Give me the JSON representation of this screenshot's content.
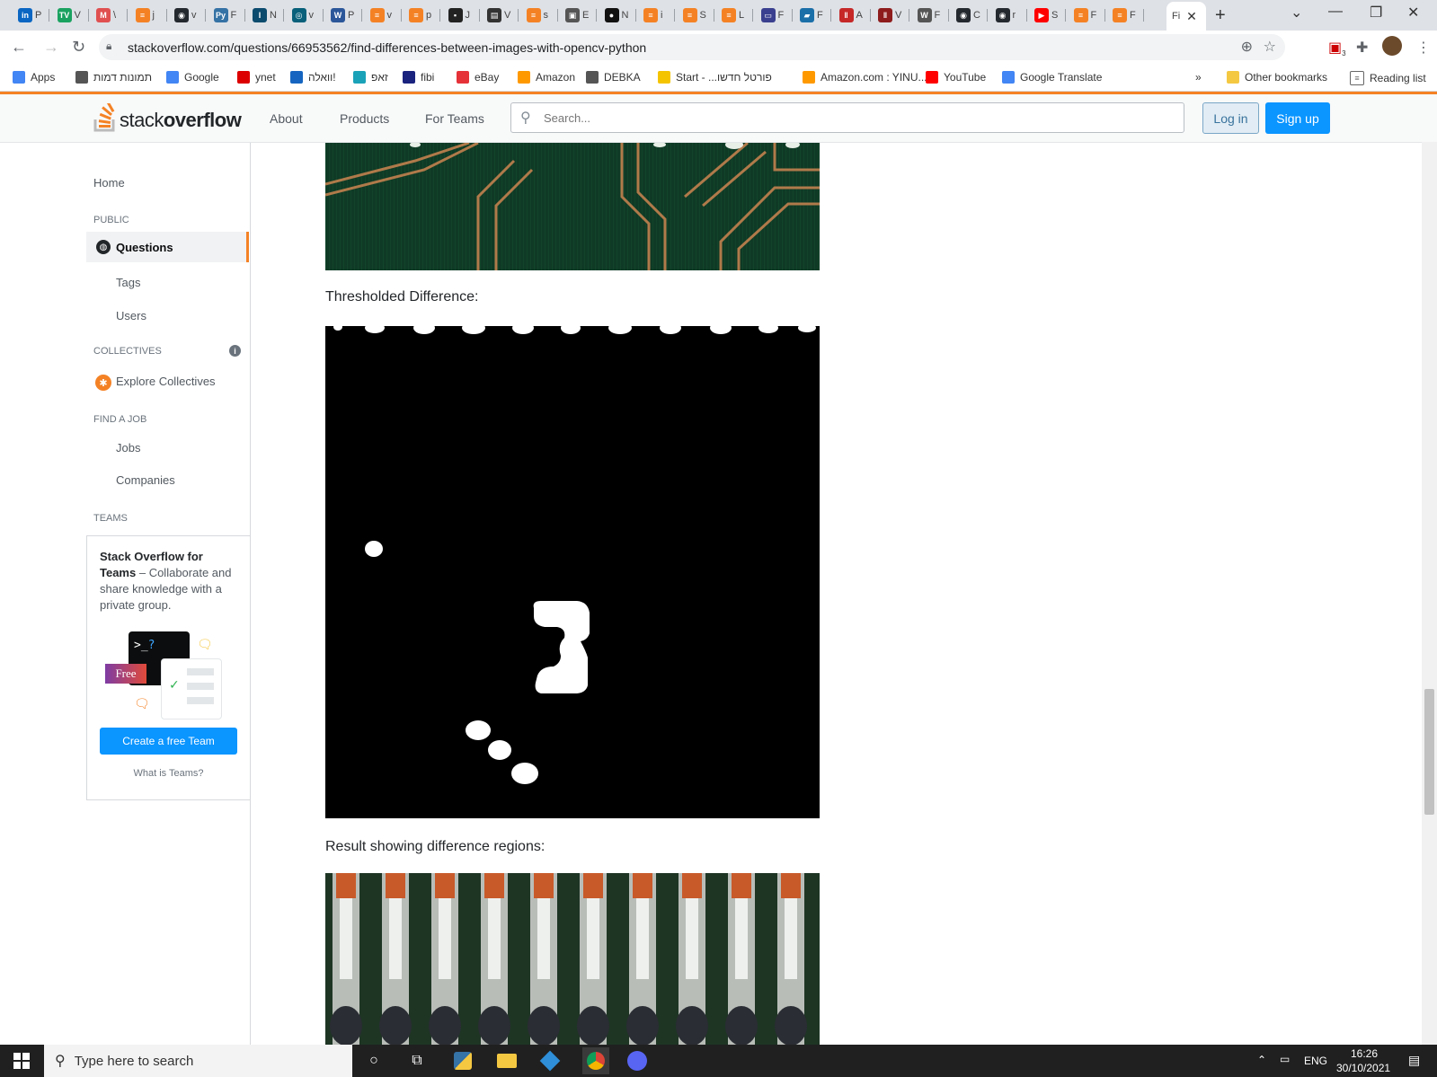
{
  "browser": {
    "tabs": [
      {
        "icon": "linkedin-icon",
        "letter": "in",
        "text": "P",
        "color": "#0a66c2"
      },
      {
        "icon": "tv-icon",
        "letter": "TV",
        "text": "V",
        "color": "#1aa260"
      },
      {
        "icon": "medium-icon",
        "letter": "M",
        "text": "\\",
        "color": "#e05050"
      },
      {
        "icon": "stackoverflow-icon",
        "letter": "≡",
        "text": "j",
        "color": "#f48225"
      },
      {
        "icon": "github-icon",
        "letter": "◉",
        "text": "v",
        "color": "#24292f"
      },
      {
        "icon": "python-icon",
        "letter": "Py",
        "text": "F",
        "color": "#3572a5"
      },
      {
        "icon": "i-icon",
        "letter": "I",
        "text": "N",
        "color": "#0b4b6e"
      },
      {
        "icon": "site-icon",
        "letter": "◎",
        "text": "v",
        "color": "#08607a"
      },
      {
        "icon": "word-icon",
        "letter": "W",
        "text": "P",
        "color": "#2b579a"
      },
      {
        "icon": "stackoverflow-icon",
        "letter": "≡",
        "text": "v",
        "color": "#f48225"
      },
      {
        "icon": "stackoverflow-icon",
        "letter": "≡",
        "text": "p",
        "color": "#f48225"
      },
      {
        "icon": "site-icon",
        "letter": "▪",
        "text": "J",
        "color": "#222"
      },
      {
        "icon": "book-icon",
        "letter": "▤",
        "text": "V",
        "color": "#333"
      },
      {
        "icon": "stackoverflow-icon",
        "letter": "≡",
        "text": "s",
        "color": "#f48225"
      },
      {
        "icon": "doc-icon",
        "letter": "▣",
        "text": "E",
        "color": "#555"
      },
      {
        "icon": "cat-icon",
        "letter": "●",
        "text": "N",
        "color": "#111"
      },
      {
        "icon": "stackoverflow-icon",
        "letter": "≡",
        "text": "i",
        "color": "#f48225"
      },
      {
        "icon": "stackoverflow-icon",
        "letter": "≡",
        "text": "S",
        "color": "#f48225"
      },
      {
        "icon": "stackoverflow-icon",
        "letter": "≡",
        "text": "L",
        "color": "#f48225"
      },
      {
        "icon": "laptop-icon",
        "letter": "▭",
        "text": "F",
        "color": "#3a3f8f"
      },
      {
        "icon": "site-icon",
        "letter": "▰",
        "text": "F",
        "color": "#1b6fa8"
      },
      {
        "icon": "bars-icon",
        "letter": "‖",
        "text": "A",
        "color": "#c62828"
      },
      {
        "icon": "bars-icon",
        "letter": "‖",
        "text": "V",
        "color": "#8e1c1c"
      },
      {
        "icon": "wikipedia-icon",
        "letter": "W",
        "text": "F",
        "color": "#555"
      },
      {
        "icon": "github-icon",
        "letter": "◉",
        "text": "C",
        "color": "#24292f"
      },
      {
        "icon": "github-icon",
        "letter": "◉",
        "text": "r",
        "color": "#24292f"
      },
      {
        "icon": "youtube-icon",
        "letter": "▶",
        "text": "S",
        "color": "#ff0000"
      },
      {
        "icon": "stackoverflow-icon",
        "letter": "≡",
        "text": "F",
        "color": "#f48225"
      },
      {
        "icon": "stackoverflow-icon",
        "letter": "≡",
        "text": "F",
        "color": "#f48225"
      }
    ],
    "active_tab": "Fi",
    "url": "stackoverflow.com/questions/66953562/find-differences-between-images-with-opencv-python",
    "extension_badge": "3",
    "bookmarks": [
      {
        "icon": "apps-icon",
        "label": "Apps"
      },
      {
        "icon": "globe-icon",
        "label": "תמונות דמות"
      },
      {
        "icon": "google-icon",
        "label": "Google"
      },
      {
        "icon": "ynet-icon",
        "label": "ynet"
      },
      {
        "icon": "walla-icon",
        "label": "וואלה!"
      },
      {
        "icon": "zap-icon",
        "label": "זאפ"
      },
      {
        "icon": "fibi-icon",
        "label": "fibi"
      },
      {
        "icon": "ebay-icon",
        "label": "eBay"
      },
      {
        "icon": "amazon-icon",
        "label": "Amazon"
      },
      {
        "icon": "debka-icon",
        "label": "DEBKA"
      },
      {
        "icon": "start-icon",
        "label": "Start - ...פורטל חדשו"
      },
      {
        "icon": "amazon-icon",
        "label": "Amazon.com : YINU..."
      },
      {
        "icon": "youtube-icon",
        "label": "YouTube"
      },
      {
        "icon": "translate-icon",
        "label": "Google Translate"
      }
    ],
    "more_bookmarks": "»",
    "other_bookmarks": "Other bookmarks",
    "reading_list": "Reading list"
  },
  "so_header": {
    "logo_light": "stack",
    "logo_bold": "overflow",
    "nav": [
      "About",
      "Products",
      "For Teams"
    ],
    "search_placeholder": "Search...",
    "login": "Log in",
    "signup": "Sign up"
  },
  "leftnav": {
    "home": "Home",
    "public_heading": "PUBLIC",
    "questions": "Questions",
    "tags": "Tags",
    "users": "Users",
    "collectives_heading": "COLLECTIVES",
    "explore_collectives": "Explore Collectives",
    "job_heading": "FIND A JOB",
    "jobs": "Jobs",
    "companies": "Companies",
    "teams_heading": "TEAMS",
    "teams_title": "Stack Overflow for Teams",
    "teams_desc": " – Collaborate and share knowledge with a private group.",
    "free_badge": "Free",
    "create_team": "Create a free Team",
    "what_is_teams": "What is Teams?"
  },
  "content": {
    "caption_threshold": "Thresholded Difference:",
    "caption_result": "Result showing difference regions:"
  },
  "taskbar": {
    "search_placeholder": "Type here to search",
    "language": "ENG",
    "time": "16:26",
    "date": "30/10/2021"
  },
  "colors": {
    "so_orange": "#f48225",
    "so_blue": "#0a95ff",
    "pcb_green": "#0f3a25",
    "trace": "#b07a4a"
  }
}
